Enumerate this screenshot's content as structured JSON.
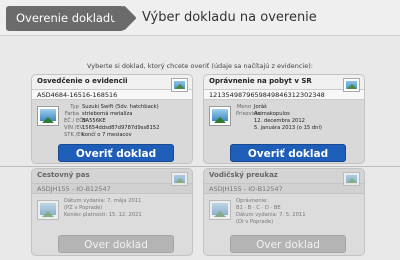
{
  "header": {
    "back_label": "Overenie dokladu",
    "title": "Výber dokladu na overenie"
  },
  "instruction": "Vyberte si doklad, ktorý chcete overiť (údaje sa načítajú z evidencie):",
  "cards": [
    {
      "title": "Osvedčenie o evidencii",
      "number": "ASD4684-16516-168516",
      "rows": [
        {
          "label": "Typ",
          "value": "Suzuki Swift (5dv. hatchback)"
        },
        {
          "label": "Farba",
          "value": "strieborná metalíza"
        },
        {
          "label": "EČ / EČV",
          "value": "BA556KE"
        },
        {
          "label": "VIN /EV",
          "value": "15654ddsd87d9787d9ss8152"
        },
        {
          "label": "STK /EK",
          "value": "končí o 7 mesiacov"
        }
      ],
      "button": "Overiť doklad"
    },
    {
      "title": "Oprávnenie na pobyt v SR",
      "number": "1213549879659849846312302348",
      "rows": [
        {
          "label": "Meno",
          "value": "Joráš"
        },
        {
          "label": "Priezvisko",
          "value": "Asimakopulos"
        },
        {
          "label": "",
          "value": "12. decembra 2012"
        },
        {
          "label": "",
          "value": "5. januára 2013 (o 15 dní)"
        }
      ],
      "button": "Overiť doklad"
    },
    {
      "title": "Cestovný pas",
      "number": "ASDJH155 - IO-B12547",
      "lines": [
        "Dátum vydania: 7. mája 2011",
        "(PZ v Poprade)",
        "Koniec platnosti: 15. 12. 2021"
      ],
      "button": "Over doklad"
    },
    {
      "title": "Vodičský preukaz",
      "number": "ASDJH155 - IO-B12547",
      "lines": [
        "Oprávnenie:",
        "B1 · B · C · D · BE",
        "Dátum vydania: 7. 5. 2011",
        "(DI v Poprade)"
      ],
      "button": "Over doklad"
    }
  ],
  "colors": {
    "primary_button": "#1e5eb8",
    "back_tab": "#6b6b6b",
    "disabled_button": "#b4b4b4"
  }
}
